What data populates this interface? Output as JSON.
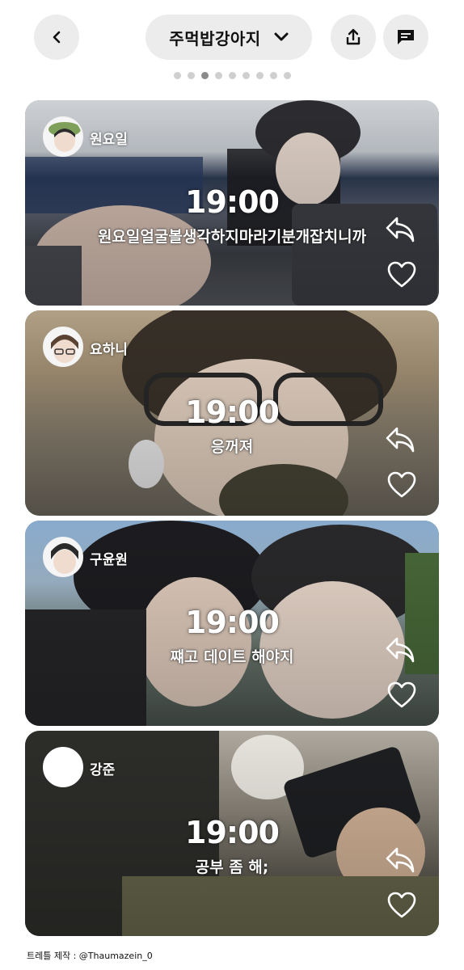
{
  "header": {
    "back_icon": "chevron-left-icon",
    "title": "주먹밥강아지",
    "dropdown_icon": "chevron-down-icon",
    "share_icon": "share-icon",
    "chat_icon": "chat-bubble-icon"
  },
  "pagination": {
    "total": 9,
    "active": 3
  },
  "cards": [
    {
      "username": "원요일",
      "time": "19:00",
      "message": "원요일얼굴볼생각하지마라기분개잡치니까",
      "liked": false
    },
    {
      "username": "요하니",
      "time": "19:00",
      "message": "응꺼져",
      "liked": false
    },
    {
      "username": "구윤원",
      "time": "19:00",
      "message": "쨰고 데이트 해야지",
      "liked": false
    },
    {
      "username": "강준",
      "time": "19:00",
      "message": "공부 좀 해;",
      "liked": false
    }
  ],
  "footer": {
    "credit": "트레틀 제작 : @Thaumazein_0"
  },
  "colors": {
    "button_bg": "#ececec",
    "dot_inactive": "#cfcfcf",
    "dot_active": "#8a8a8a",
    "text_on_image": "#ffffff"
  }
}
